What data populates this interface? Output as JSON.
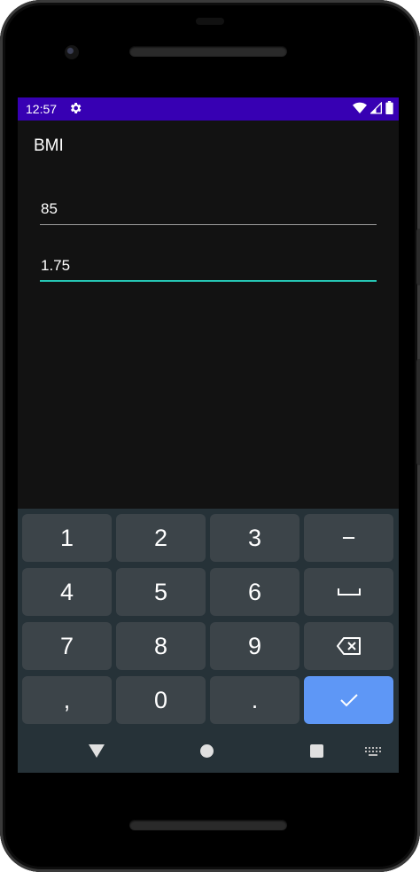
{
  "status_bar": {
    "time": "12:57",
    "icons": [
      "settings-icon",
      "wifi-icon",
      "signal-icon",
      "battery-icon"
    ]
  },
  "app": {
    "title": "BMI"
  },
  "fields": [
    {
      "value": "85",
      "focused": false
    },
    {
      "value": "1.75",
      "focused": true
    }
  ],
  "keyboard": {
    "keys": [
      [
        "1",
        "2",
        "3",
        "−"
      ],
      [
        "4",
        "5",
        "6",
        "space-icon"
      ],
      [
        "7",
        "8",
        "9",
        "backspace-icon"
      ],
      [
        ",",
        "0",
        ".",
        "check-icon"
      ]
    ],
    "done_color": "#5e97f6"
  },
  "nav_bar": {
    "icons": [
      "back-icon",
      "home-icon",
      "recents-icon",
      "keyboard-switch-icon"
    ]
  },
  "colors": {
    "status_bar": "#3700b3",
    "accent": "#26c6b4",
    "background": "#121212",
    "keyboard": "#263238"
  }
}
